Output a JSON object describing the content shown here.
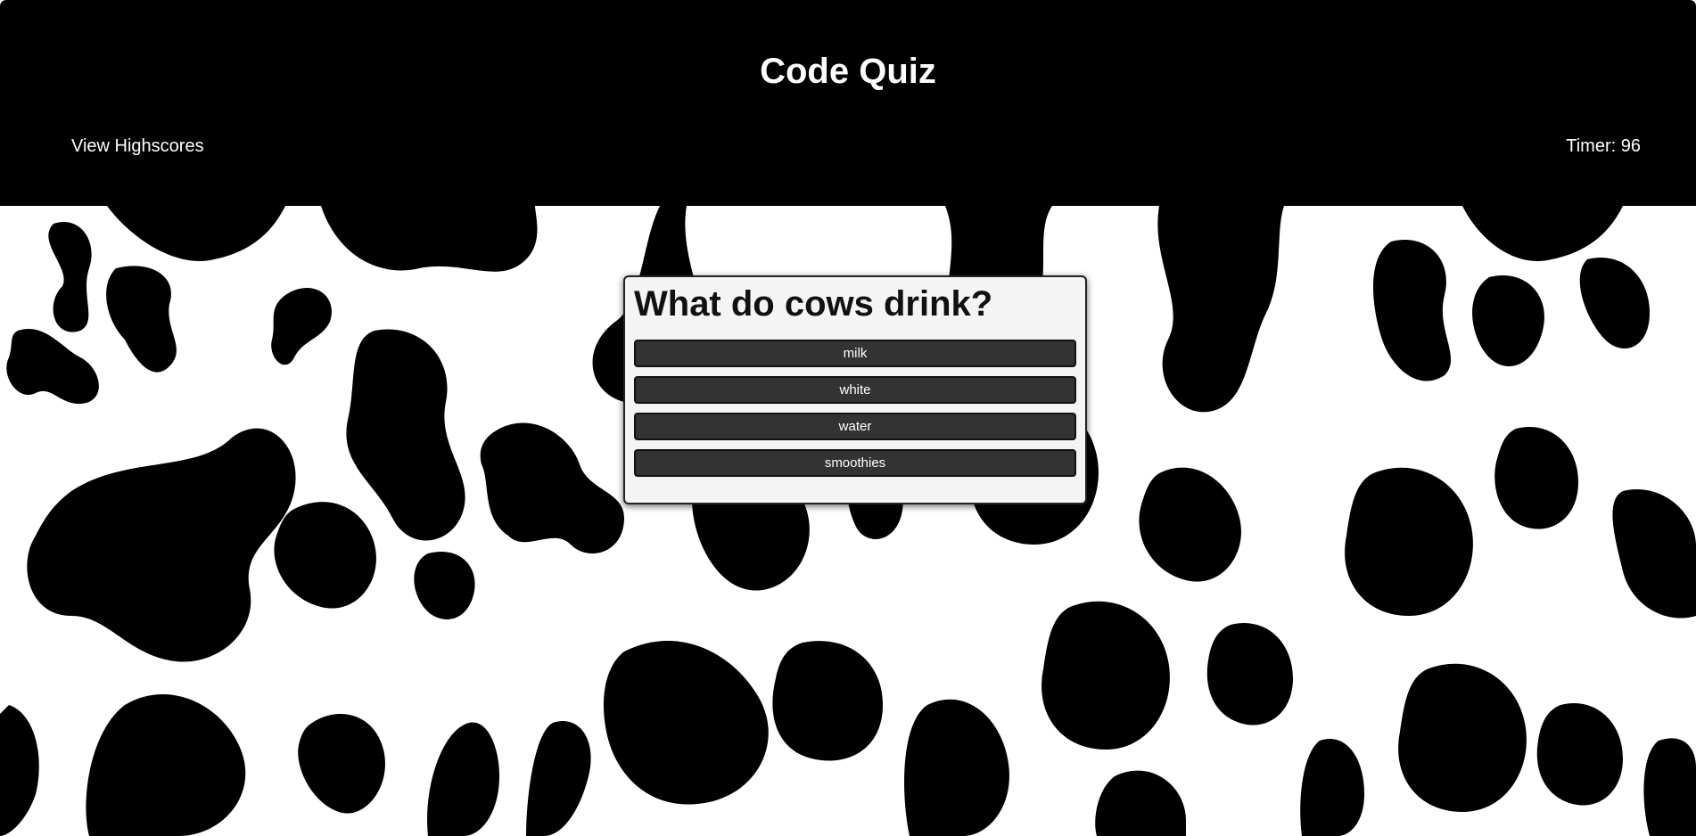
{
  "header": {
    "title": "Code Quiz",
    "highscores_link": "View Highscores",
    "timer": "Timer: 96"
  },
  "quiz": {
    "question": "What do cows drink?",
    "answers": [
      "milk",
      "white",
      "water",
      "smoothies"
    ]
  },
  "theme": {
    "header_bg": "#000000",
    "card_bg": "#f4f4f4",
    "button_bg": "#333333",
    "button_text": "#ffffff"
  },
  "background": {
    "pattern": "cow-print"
  }
}
